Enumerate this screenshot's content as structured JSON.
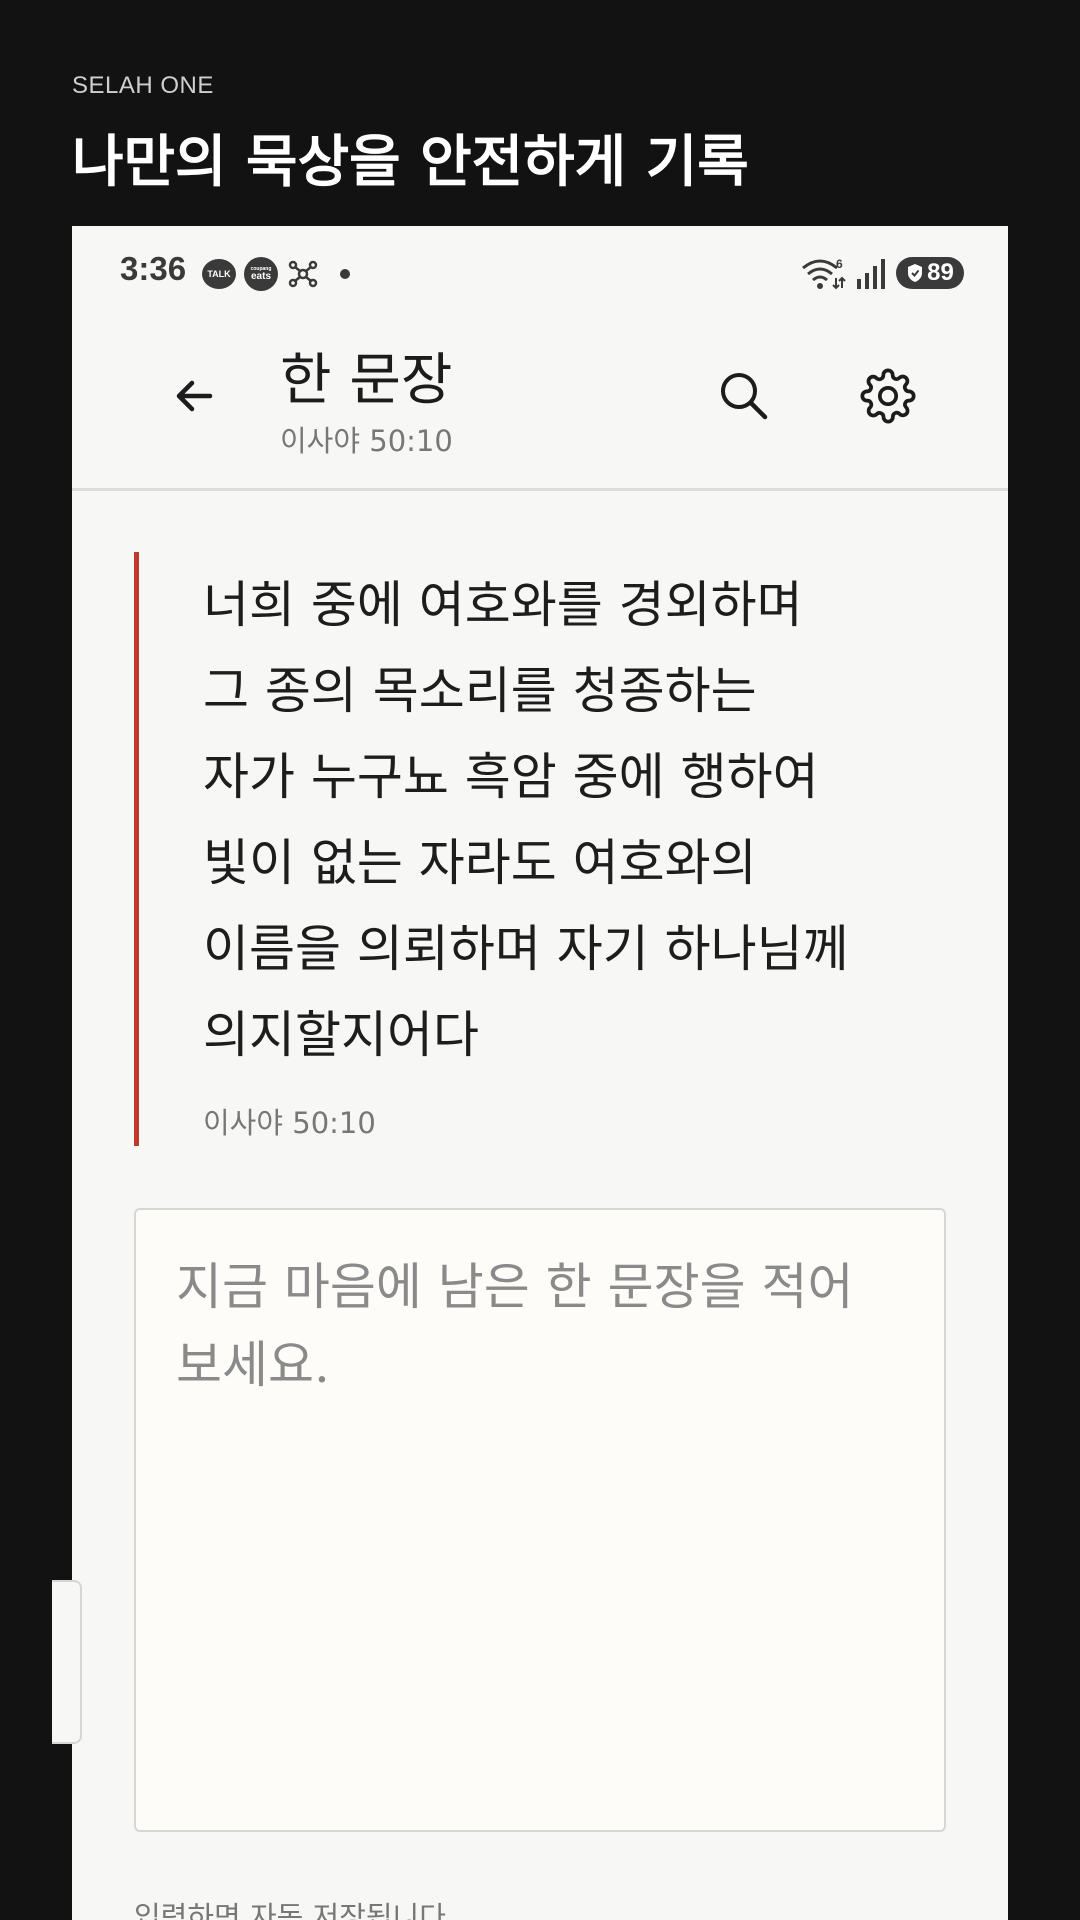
{
  "header": {
    "brand": "SELAH ONE",
    "headline": "나만의 묵상을 안전하게 기록"
  },
  "status_bar": {
    "time": "3:36",
    "talk_icon_text": "TALK",
    "eats_icon_top": "coupang",
    "eats_icon_text": "eats",
    "wifi_label": "6",
    "battery": "89"
  },
  "app_bar": {
    "title": "한 문장",
    "subtitle": "이사야 50:10"
  },
  "verse": {
    "lines": [
      "너희 중에 여호와를 경외하며",
      "그 종의 목소리를 청종하는",
      "자가 누구뇨 흑암 중에 행하여",
      "빛이 없는 자라도 여호와의",
      "이름을 의뢰하며 자기 하나님께",
      "의지할지어다"
    ],
    "reference": "이사야 50:10",
    "accent_color": "#c0392b"
  },
  "note": {
    "value": "",
    "placeholder": "지금 마음에 남은 한 문장을 적어 보세요."
  },
  "hint": "입력하면 자동 저장됩니다"
}
